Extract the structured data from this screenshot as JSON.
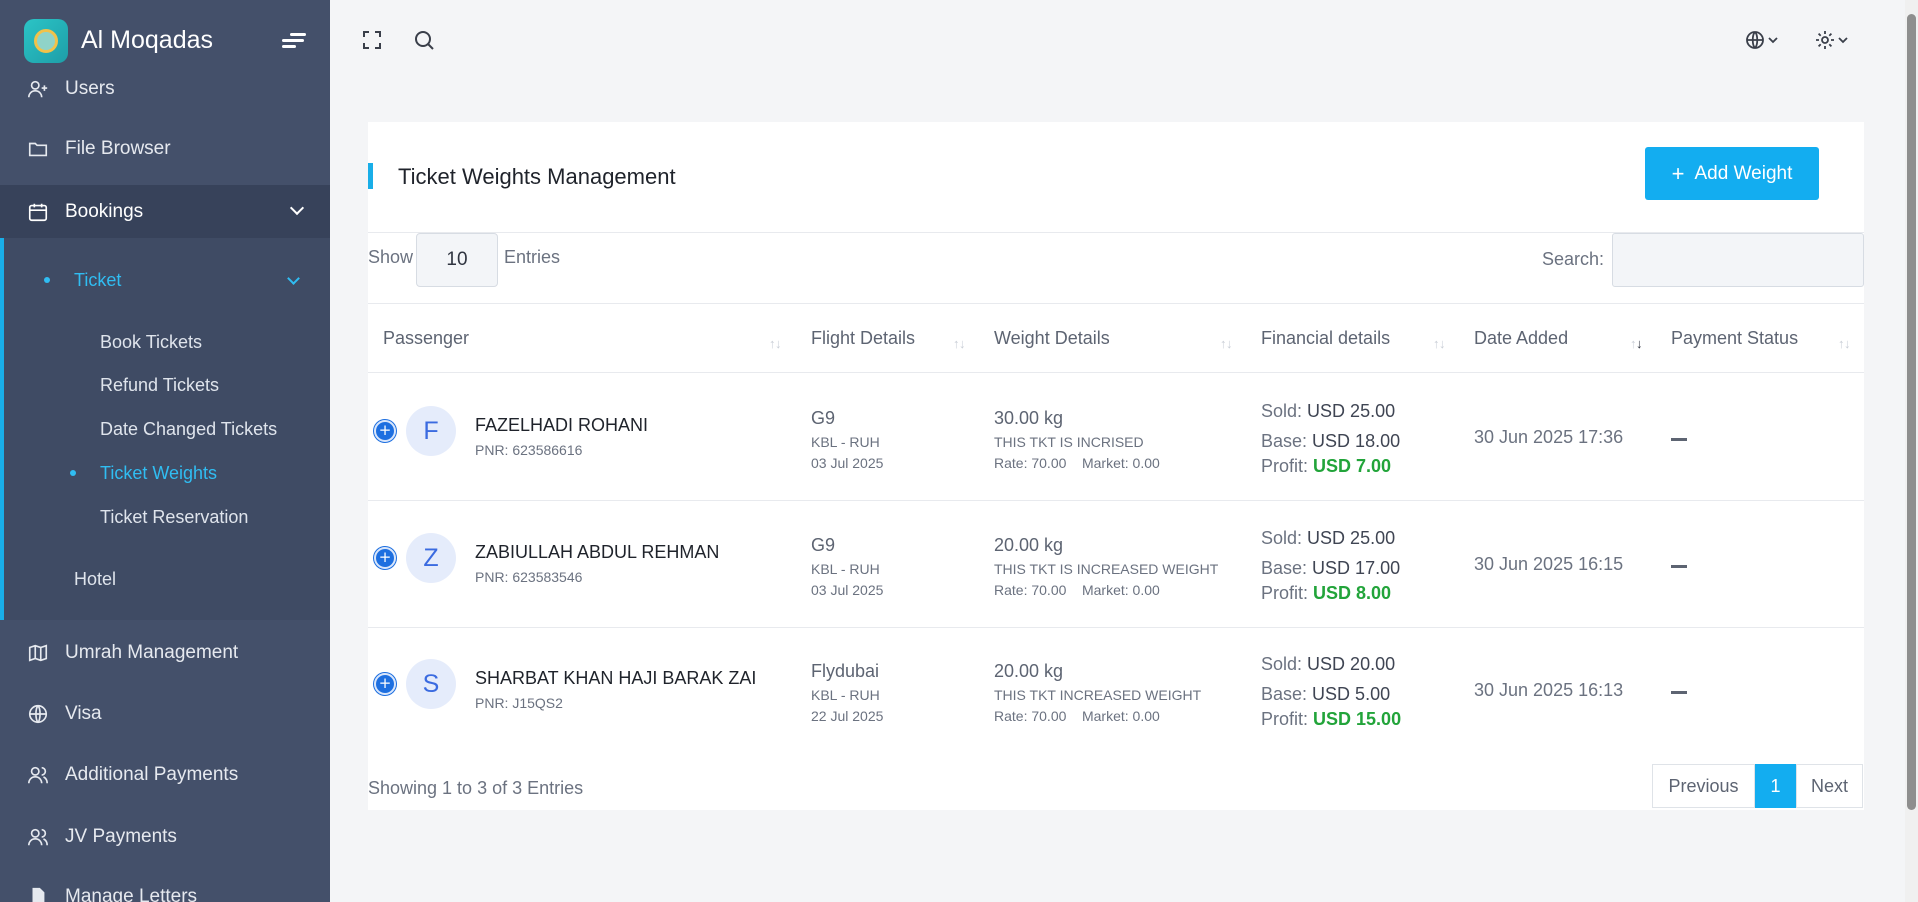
{
  "app": {
    "name": "Al Moqadas"
  },
  "sidebar": {
    "items": [
      {
        "label": "Users"
      },
      {
        "label": "File Browser"
      },
      {
        "label": "Bookings"
      },
      {
        "label": "Umrah Management"
      },
      {
        "label": "Visa"
      },
      {
        "label": "Additional Payments"
      },
      {
        "label": "JV Payments"
      },
      {
        "label": "Manage Letters"
      }
    ],
    "bookings_sub": {
      "ticket": "Ticket",
      "ticket_sub": [
        "Book Tickets",
        "Refund Tickets",
        "Date Changed Tickets",
        "Ticket Weights",
        "Ticket Reservation"
      ],
      "hotel": "Hotel"
    }
  },
  "page": {
    "title": "Ticket Weights Management",
    "add_button": "Add Weight",
    "show_label": "Show",
    "entries_value": "10",
    "entries_label": "Entries",
    "search_label": "Search:",
    "search_value": "",
    "columns": [
      "Passenger",
      "Flight Details",
      "Weight Details",
      "Financial details",
      "Date Added",
      "Payment Status"
    ],
    "footer": "Showing 1 to 3 of 3 Entries",
    "pagination": {
      "prev": "Previous",
      "page": "1",
      "next": "Next"
    }
  },
  "labels": {
    "sold": "Sold:",
    "base": "Base:",
    "profit": "Profit:",
    "rate": "Rate:",
    "market": "Market:"
  },
  "rows": [
    {
      "initial": "F",
      "name": "FAZELHADI ROHANI",
      "pnr": "PNR: 623586616",
      "airline": "G9",
      "route": "KBL - RUH",
      "flight_date": "03 Jul 2025",
      "weight": "30.00 kg",
      "note": "THIS TKT IS INCRISED",
      "rate": "70.00",
      "market": "0.00",
      "sold": "USD 25.00",
      "base": "USD 18.00",
      "profit": "USD 7.00",
      "date_added": "30 Jun 2025 17:36"
    },
    {
      "initial": "Z",
      "name": "ZABIULLAH ABDUL REHMAN",
      "pnr": "PNR: 623583546",
      "airline": "G9",
      "route": "KBL - RUH",
      "flight_date": "03 Jul 2025",
      "weight": "20.00 kg",
      "note": "THIS TKT IS INCREASED WEIGHT",
      "rate": "70.00",
      "market": "0.00",
      "sold": "USD 25.00",
      "base": "USD 17.00",
      "profit": "USD 8.00",
      "date_added": "30 Jun 2025 16:15"
    },
    {
      "initial": "S",
      "name": "SHARBAT KHAN HAJI BARAK ZAI",
      "pnr": "PNR: J15QS2",
      "airline": "Flydubai",
      "route": "KBL - RUH",
      "flight_date": "22 Jul 2025",
      "weight": "20.00 kg",
      "note": "THIS TKT INCREASED WEIGHT",
      "rate": "70.00",
      "market": "0.00",
      "sold": "USD 20.00",
      "base": "USD 5.00",
      "profit": "USD 15.00",
      "date_added": "30 Jun 2025 16:13"
    }
  ],
  "colors": {
    "accent": "#13adf0",
    "sidebar": "#44506a",
    "profit": "#22a43a"
  }
}
